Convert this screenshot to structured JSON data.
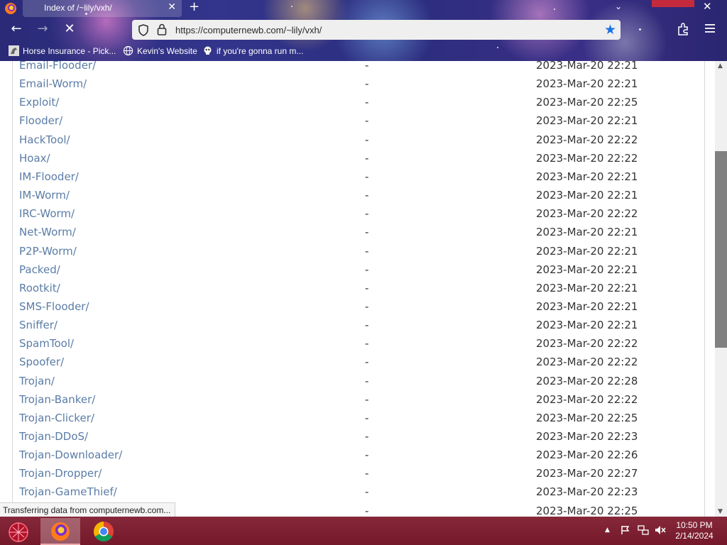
{
  "browser": {
    "tab_title": "Index of /~lily/vxh/",
    "url": "https://computernewb.com/~lily/vxh/",
    "bookmarks": [
      {
        "label": "Horse Insurance - Pick..."
      },
      {
        "label": "Kevin's Website"
      },
      {
        "label": "if you're gonna run m..."
      }
    ],
    "status_text": "Transferring data from computernewb.com..."
  },
  "listing": {
    "rows": [
      {
        "name": "Email-Flooder/",
        "size": "-",
        "date": "2023-Mar-20 22:21"
      },
      {
        "name": "Email-Worm/",
        "size": "-",
        "date": "2023-Mar-20 22:21"
      },
      {
        "name": "Exploit/",
        "size": "-",
        "date": "2023-Mar-20 22:25"
      },
      {
        "name": "Flooder/",
        "size": "-",
        "date": "2023-Mar-20 22:21"
      },
      {
        "name": "HackTool/",
        "size": "-",
        "date": "2023-Mar-20 22:22"
      },
      {
        "name": "Hoax/",
        "size": "-",
        "date": "2023-Mar-20 22:22"
      },
      {
        "name": "IM-Flooder/",
        "size": "-",
        "date": "2023-Mar-20 22:21"
      },
      {
        "name": "IM-Worm/",
        "size": "-",
        "date": "2023-Mar-20 22:21"
      },
      {
        "name": "IRC-Worm/",
        "size": "-",
        "date": "2023-Mar-20 22:22"
      },
      {
        "name": "Net-Worm/",
        "size": "-",
        "date": "2023-Mar-20 22:21"
      },
      {
        "name": "P2P-Worm/",
        "size": "-",
        "date": "2023-Mar-20 22:21"
      },
      {
        "name": "Packed/",
        "size": "-",
        "date": "2023-Mar-20 22:21"
      },
      {
        "name": "Rootkit/",
        "size": "-",
        "date": "2023-Mar-20 22:21"
      },
      {
        "name": "SMS-Flooder/",
        "size": "-",
        "date": "2023-Mar-20 22:21"
      },
      {
        "name": "Sniffer/",
        "size": "-",
        "date": "2023-Mar-20 22:21"
      },
      {
        "name": "SpamTool/",
        "size": "-",
        "date": "2023-Mar-20 22:22"
      },
      {
        "name": "Spoofer/",
        "size": "-",
        "date": "2023-Mar-20 22:22"
      },
      {
        "name": "Trojan/",
        "size": "-",
        "date": "2023-Mar-20 22:28"
      },
      {
        "name": "Trojan-Banker/",
        "size": "-",
        "date": "2023-Mar-20 22:22"
      },
      {
        "name": "Trojan-Clicker/",
        "size": "-",
        "date": "2023-Mar-20 22:25"
      },
      {
        "name": "Trojan-DDoS/",
        "size": "-",
        "date": "2023-Mar-20 22:23"
      },
      {
        "name": "Trojan-Downloader/",
        "size": "-",
        "date": "2023-Mar-20 22:26"
      },
      {
        "name": "Trojan-Dropper/",
        "size": "-",
        "date": "2023-Mar-20 22:27"
      },
      {
        "name": "Trojan-GameThief/",
        "size": "-",
        "date": "2023-Mar-20 22:23"
      },
      {
        "name": "",
        "size": "-",
        "date": "2023-Mar-20 22:25"
      }
    ]
  },
  "taskbar": {
    "time": "10:50 PM",
    "date": "2/14/2024",
    "apps": [
      "firefox-icon",
      "chrome-icon"
    ]
  },
  "colors": {
    "link": "#5a7ca6",
    "taskbar": "#7a1f2e",
    "star": "#1a73e8"
  }
}
